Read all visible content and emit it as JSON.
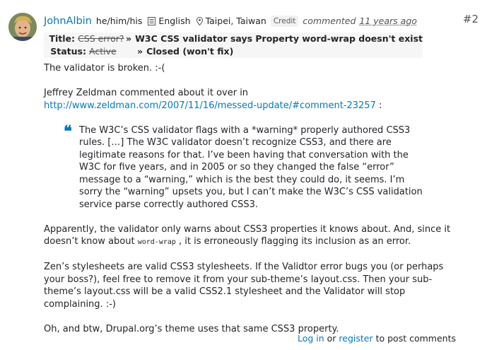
{
  "comment": {
    "author": "JohnAlbin",
    "pronouns": "he/him/his",
    "language": "English",
    "location": "Taipei, Taiwan",
    "credit_badge": "Credit",
    "commented_label": "commented",
    "time_ago": "11 years ago",
    "number": "#2"
  },
  "issue_changes": [
    {
      "label": "Title:",
      "old": "CSS error?",
      "arrow": "»",
      "new": "W3C CSS validator says Property word-wrap doesn't exist"
    },
    {
      "label": "Status:",
      "old": "Active",
      "arrow": "»",
      "new": "Closed (won't fix)"
    }
  ],
  "body": {
    "p1": "The validator is broken. :-(",
    "p2_text": "Jeffrey Zeldman commented about it over in",
    "p2_link": "http://www.zeldman.com/2007/11/16/messed-update/#comment-23257",
    "p2_suffix": " :",
    "quote_mark": "“",
    "quote": "The W3C’s CSS validator flags with a *warning* properly authored CSS3 rules. […] The W3C validator doesn’t recognize CSS3, and there are legitimate reasons for that. I’ve been having that conversation with the W3C for five years, and in 2005 or so they changed the false “error” message to a “warning,” which is the best they could do, it seems. I’m sorry the “warning” upsets you, but I can’t make the W3C’s CSS validation service parse correctly authored CSS3.",
    "p3_a": "Apparently, the validator only warns about CSS3 properties it knows about. And, since it doesn’t know about ",
    "p3_code": "word-wrap",
    "p3_b": " , it is erroneously flagging its inclusion as an error.",
    "p4": "Zen’s stylesheets are valid CSS3 stylesheets. If the Validtor error bugs you (or perhaps your boss?), feel free to remove it from your sub-theme’s layout.css. Then your sub-theme’s layout.css will be a valid CSS2.1 stylesheet and the Validator will stop complaining. :-)",
    "p5": "Oh, and btw, Drupal.org’s theme uses that same CSS3 property."
  },
  "footer": {
    "login": "Log in",
    "or": " or ",
    "register": "register",
    "suffix": " to post comments"
  },
  "colors": {
    "link": "#0678be",
    "text": "#232429",
    "muted": "#545454",
    "changes_bg": "#f6f6f6"
  },
  "icons": {
    "language": "document-icon",
    "location": "map-pin-icon",
    "quote": "quote-icon"
  }
}
